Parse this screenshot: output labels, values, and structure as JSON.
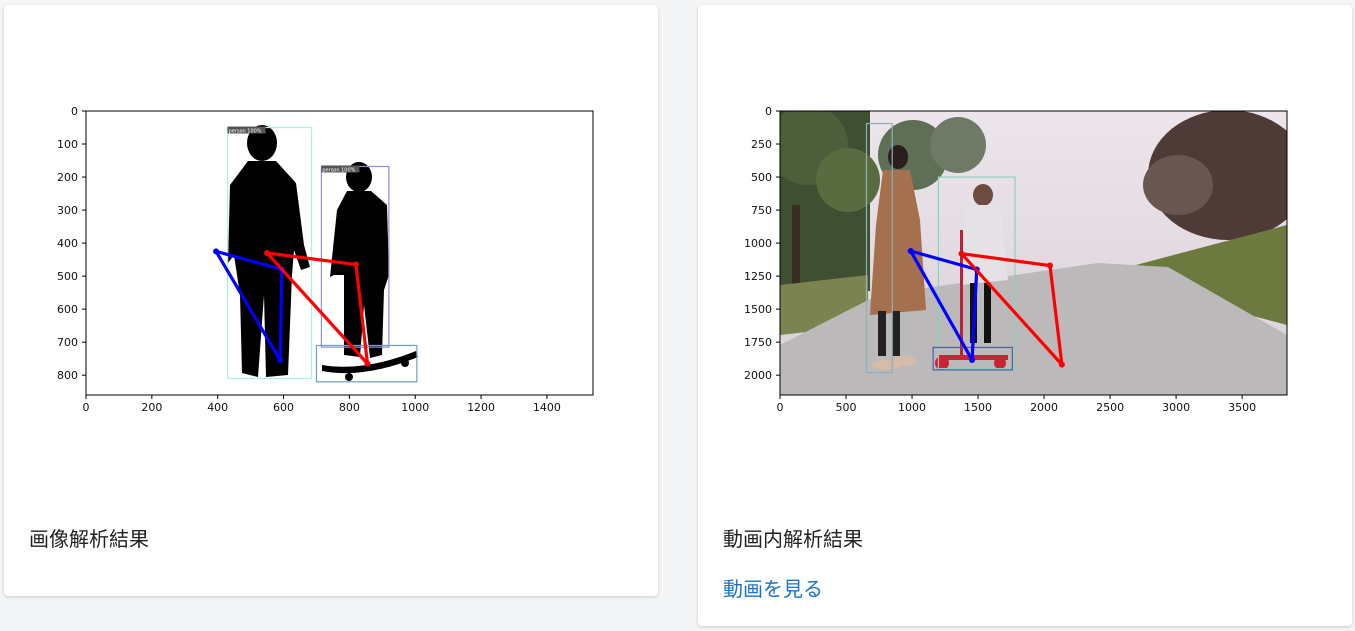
{
  "cards": [
    {
      "title": "画像解析結果",
      "chart_data": {
        "type": "scatter",
        "image_plot": true,
        "xlim": [
          0,
          1540
        ],
        "ylim": [
          860,
          0
        ],
        "xticks": [
          0,
          200,
          400,
          600,
          800,
          1000,
          1200,
          1400
        ],
        "yticks": [
          0,
          100,
          200,
          300,
          400,
          500,
          600,
          700,
          800
        ],
        "boxes": [
          {
            "label": "person 100%",
            "x0": 430,
            "y0": 50,
            "x1": 685,
            "y1": 810,
            "color": "#a6f0ee"
          },
          {
            "label": "person 100%",
            "x0": 715,
            "y0": 168,
            "x1": 920,
            "y1": 715,
            "color": "#8f8fdc"
          },
          {
            "label": "",
            "x0": 700,
            "y0": 710,
            "x1": 1005,
            "y1": 820,
            "color": "#6f9dc4"
          }
        ],
        "series": [
          {
            "color": "#0000ff",
            "points": [
              [
                395,
                425
              ],
              [
                595,
                480
              ],
              [
                590,
                755
              ],
              [
                395,
                425
              ]
            ]
          },
          {
            "color": "#ff0000",
            "points": [
              [
                550,
                430
              ],
              [
                820,
                465
              ],
              [
                855,
                765
              ],
              [
                550,
                430
              ]
            ]
          }
        ]
      }
    },
    {
      "title": "動画内解析結果",
      "link": "動画を見る",
      "chart_data": {
        "type": "scatter",
        "image_plot": true,
        "xlim": [
          0,
          3840
        ],
        "ylim": [
          2150,
          0
        ],
        "xticks": [
          0,
          500,
          1000,
          1500,
          2000,
          2500,
          3000,
          3500
        ],
        "yticks": [
          0,
          250,
          500,
          750,
          1000,
          1250,
          1500,
          1750,
          2000
        ],
        "boxes": [
          {
            "label": "",
            "x0": 655,
            "y0": 95,
            "x1": 850,
            "y1": 1980,
            "color": "#8fb0b8"
          },
          {
            "label": "",
            "x0": 1200,
            "y0": 500,
            "x1": 1780,
            "y1": 1950,
            "color": "#8fd0c0"
          },
          {
            "label": "",
            "x0": 1160,
            "y0": 1790,
            "x1": 1760,
            "y1": 1960,
            "color": "#5060a0"
          }
        ],
        "series": [
          {
            "color": "#0000ff",
            "points": [
              [
                990,
                1060
              ],
              [
                1490,
                1200
              ],
              [
                1455,
                1885
              ],
              [
                990,
                1060
              ]
            ]
          },
          {
            "color": "#ff0000",
            "points": [
              [
                1375,
                1080
              ],
              [
                2045,
                1170
              ],
              [
                2135,
                1920
              ],
              [
                1375,
                1080
              ]
            ]
          }
        ]
      }
    }
  ]
}
